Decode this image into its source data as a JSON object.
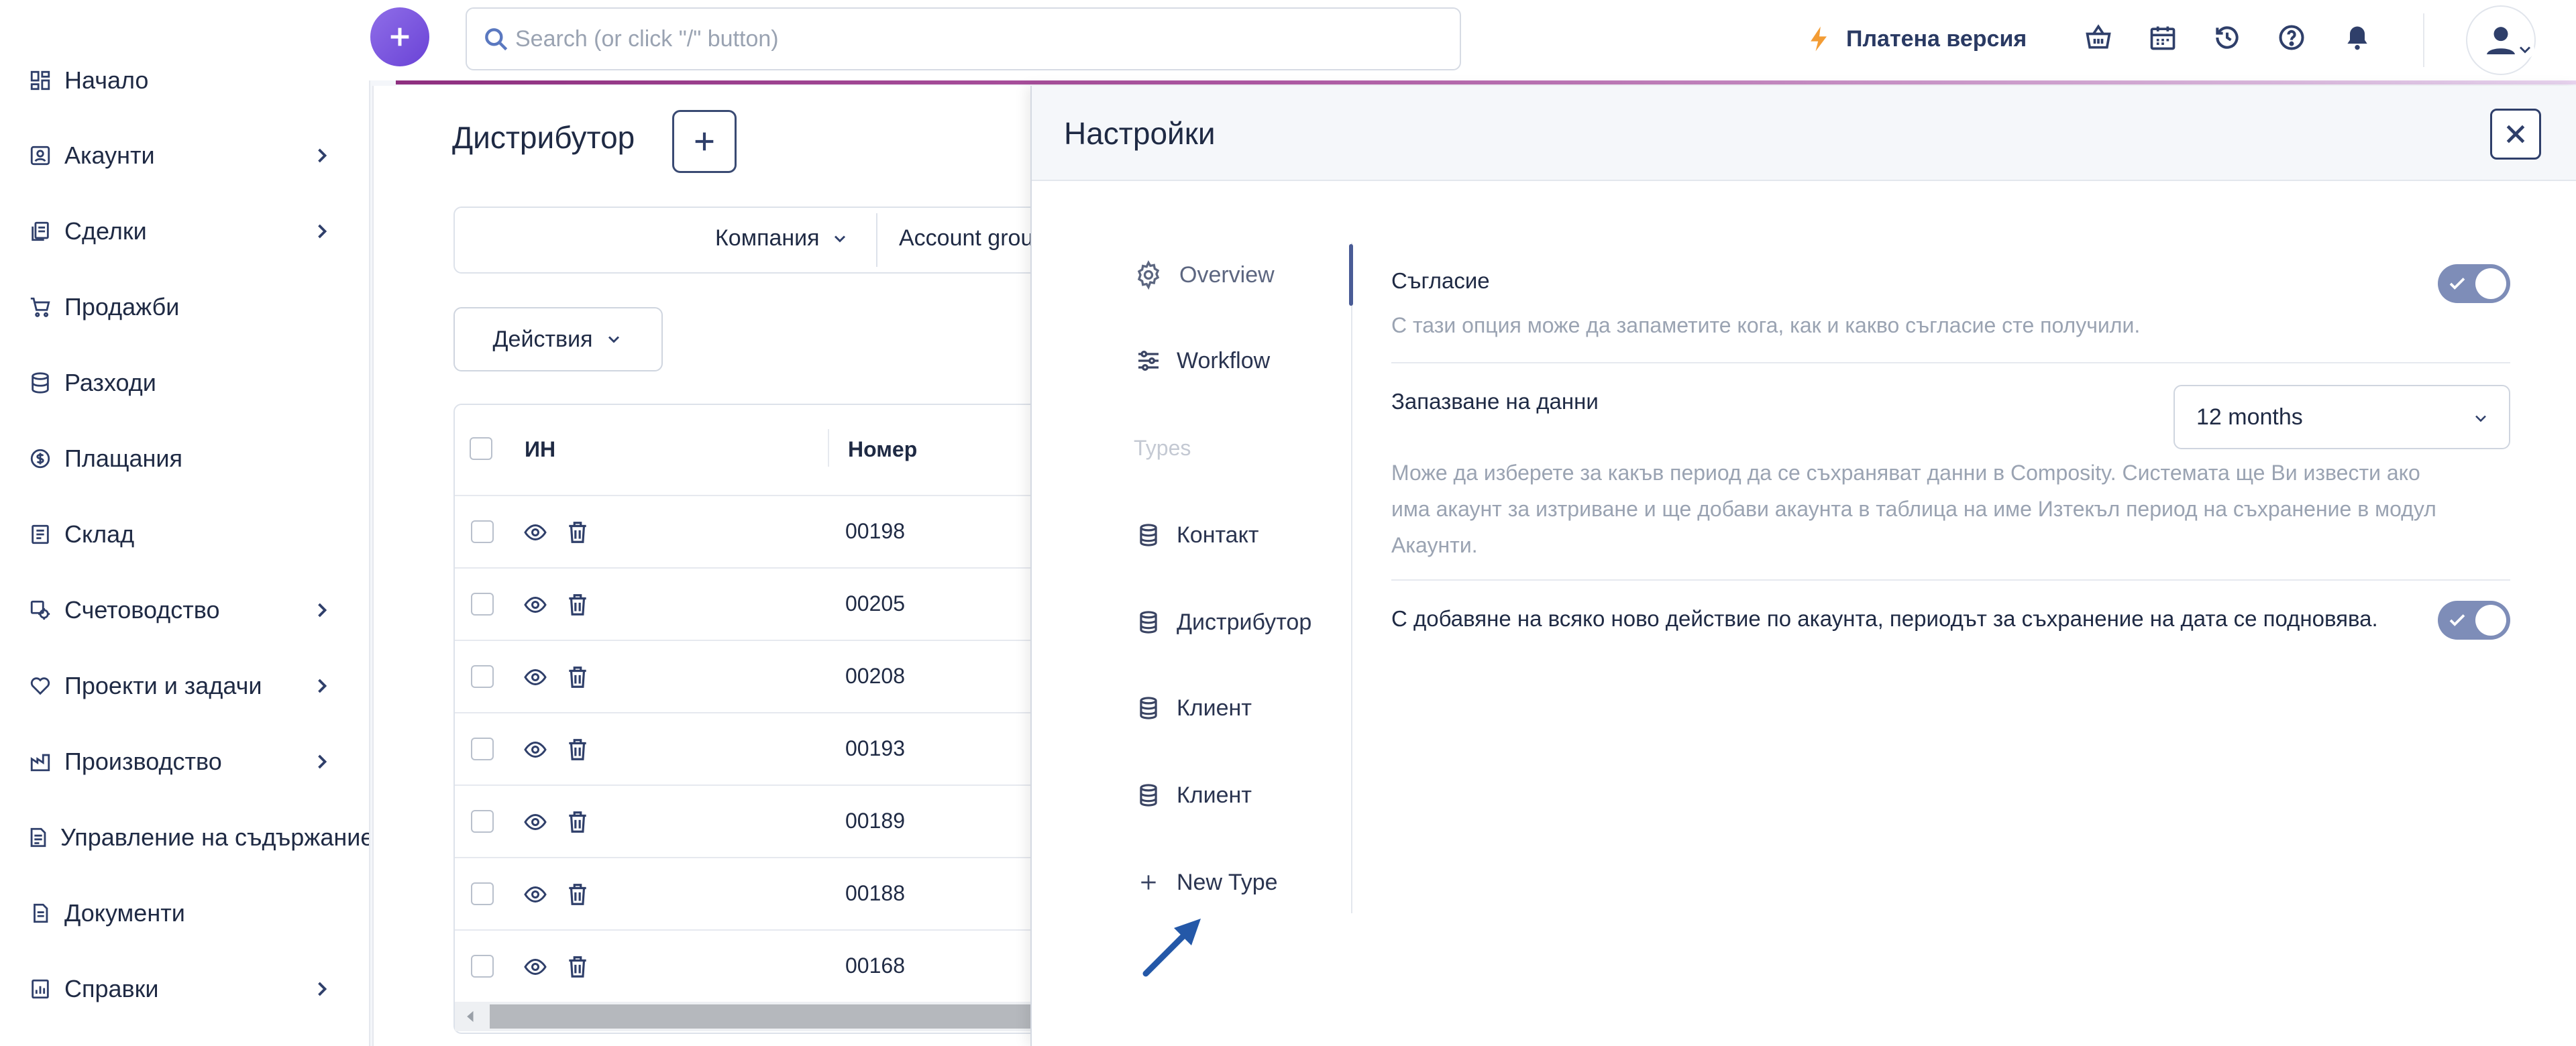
{
  "sidebar": {
    "items": [
      {
        "label": "Начало",
        "icon": "dashboard-icon",
        "has_submenu": false
      },
      {
        "label": "Акаунти",
        "icon": "contact-card-icon",
        "has_submenu": true
      },
      {
        "label": "Сделки",
        "icon": "documents-icon",
        "has_submenu": true
      },
      {
        "label": "Продажби",
        "icon": "cart-icon",
        "has_submenu": false
      },
      {
        "label": "Разходи",
        "icon": "database-icon",
        "has_submenu": false
      },
      {
        "label": "Плащания",
        "icon": "dollar-circle-icon",
        "has_submenu": false
      },
      {
        "label": "Склад",
        "icon": "clipboard-icon",
        "has_submenu": false
      },
      {
        "label": "Счетоводство",
        "icon": "gear-calc-icon",
        "has_submenu": true
      },
      {
        "label": "Проекти и задачи",
        "icon": "heart-handshake-icon",
        "has_submenu": true
      },
      {
        "label": "Производство",
        "icon": "factory-icon",
        "has_submenu": true
      },
      {
        "label": "Управление на съдържание",
        "icon": "content-doc-icon",
        "has_submenu": true
      },
      {
        "label": "Документи",
        "icon": "document-icon",
        "has_submenu": false
      },
      {
        "label": "Справки",
        "icon": "report-icon",
        "has_submenu": true
      }
    ]
  },
  "header": {
    "search_placeholder": "Search (or click \"/\" button)",
    "plan_label": "Платена версия",
    "icons": [
      "basket-icon",
      "calendar-icon",
      "history-icon",
      "help-icon",
      "bell-icon"
    ]
  },
  "main": {
    "title": "Дистрибутор",
    "filters": {
      "company": "Компания",
      "account_group": "Account grou"
    },
    "actions_label": "Действия",
    "table": {
      "columns": [
        "ИН",
        "Номер"
      ],
      "rows": [
        {
          "number": "00198"
        },
        {
          "number": "00205"
        },
        {
          "number": "00208"
        },
        {
          "number": "00193"
        },
        {
          "number": "00189"
        },
        {
          "number": "00188"
        },
        {
          "number": "00168"
        }
      ]
    }
  },
  "settings": {
    "title": "Настройки",
    "nav": {
      "overview": "Overview",
      "workflow": "Workflow",
      "types_heading": "Types",
      "types": [
        "Контакт",
        "Дистрибутор",
        "Клиент",
        "Клиент"
      ],
      "new_type": "New Type"
    },
    "consent": {
      "label": "Съгласие",
      "description": "С тази опция може да запаметите кога, как и какво съгласие сте получили.",
      "enabled": true
    },
    "retention": {
      "label": "Запазване на данни",
      "value": "12 months",
      "description_lines": [
        "Може да изберете за какъв период да се съхраняват данни в Composity. Системата ще Ви извести ако",
        "има акаунт за изтриване и ще добави акаунта в таблица на име Изтекъл период на съхранение в модул",
        "Акаунти."
      ]
    },
    "renew": {
      "label": "С добавяне на всяко ново действие по акаунта, периодът за съхранение на дата се подновява.",
      "enabled": true
    }
  },
  "colors": {
    "accent": "#7e8db8",
    "brand_purple": "#7b56e0",
    "plan_bolt": "#f39c34",
    "navy": "#2f3f6a"
  }
}
